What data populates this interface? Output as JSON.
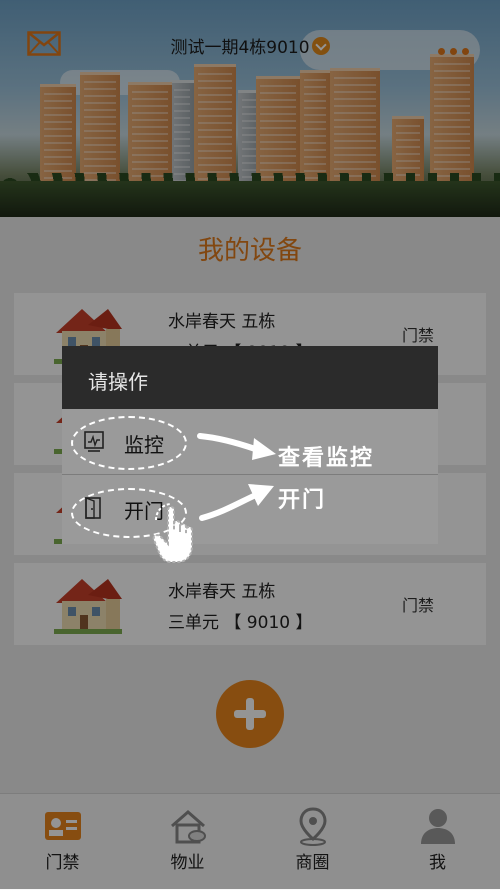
{
  "header": {
    "title": "测试一期4栋9010",
    "icons": {
      "mail": "mail-icon",
      "dropdown": "chevron-down-icon",
      "more": "more-dots-icon"
    },
    "accent": "#e28a1c"
  },
  "section": {
    "title": "我的设备"
  },
  "devices": [
    {
      "line1": "水岸春天   五栋",
      "line2": "一单元   【 9010 】",
      "type": "门禁"
    },
    {
      "line1": "",
      "line2": "",
      "type": ""
    },
    {
      "line1": "",
      "line2": "",
      "type": ""
    },
    {
      "line1": "水岸春天   五栋",
      "line2": "三单元   【 9010 】",
      "type": "门禁"
    }
  ],
  "add_button": {
    "icon": "plus-icon"
  },
  "dialog": {
    "title": "请操作",
    "options": [
      {
        "label": "监控",
        "icon": "monitor-icon"
      },
      {
        "label": "开门",
        "icon": "door-icon"
      }
    ]
  },
  "annotations": {
    "monitor_hint": "查看监控",
    "door_hint": "开门"
  },
  "bottom_nav": [
    {
      "label": "门禁",
      "icon": "access-card-icon",
      "active": true
    },
    {
      "label": "物业",
      "icon": "property-house-icon",
      "active": false
    },
    {
      "label": "商圈",
      "icon": "location-pin-icon",
      "active": false
    },
    {
      "label": "我",
      "icon": "person-icon",
      "active": false
    }
  ]
}
